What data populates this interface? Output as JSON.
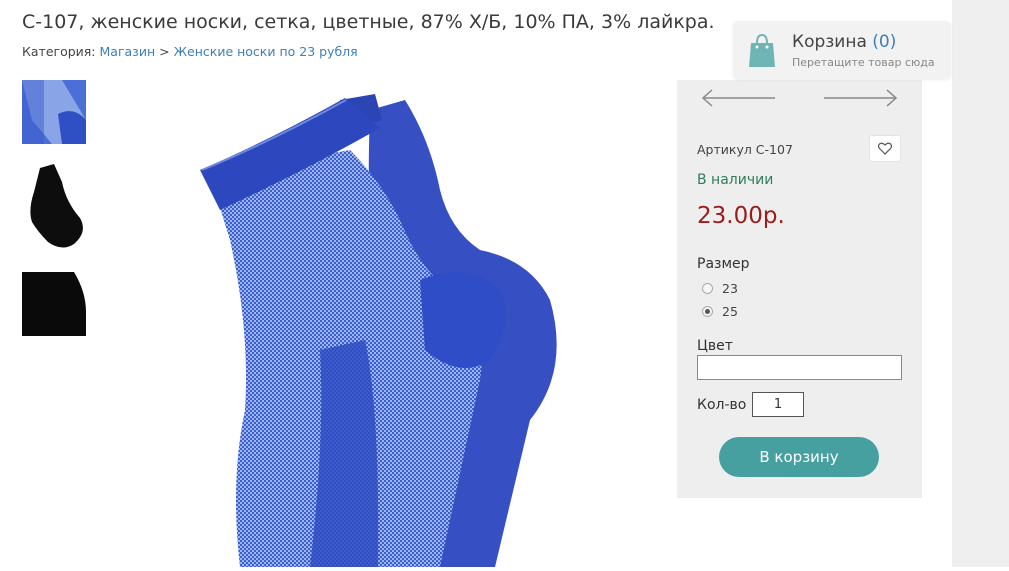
{
  "product": {
    "title": "С-107, женские носки, сетка, цветные, 87% Х/Б, 10% ПА, 3% лайкра.",
    "sku_label": "Артикул С-107",
    "availability": "В наличии",
    "price": "23.00р.",
    "main_image_color": "#3353c3"
  },
  "breadcrumb": {
    "prefix": "Категория:",
    "link1": "Магазин",
    "separator": ">",
    "link2": "Женские носки по 23 рубля"
  },
  "cart": {
    "title": "Корзина",
    "count": "(0)",
    "hint": "Перетащите товар сюда"
  },
  "options": {
    "size_label": "Размер",
    "sizes": [
      {
        "label": "23",
        "selected": false
      },
      {
        "label": "25",
        "selected": true
      }
    ],
    "color_label": "Цвет",
    "color_value": "",
    "qty_label": "Кол-во",
    "qty_value": "1"
  },
  "buy_button": "В корзину",
  "colors": {
    "accent": "#47a0a0",
    "price": "#9b1c1c",
    "stock": "#2e7d5b",
    "link": "#3d7fb8"
  }
}
